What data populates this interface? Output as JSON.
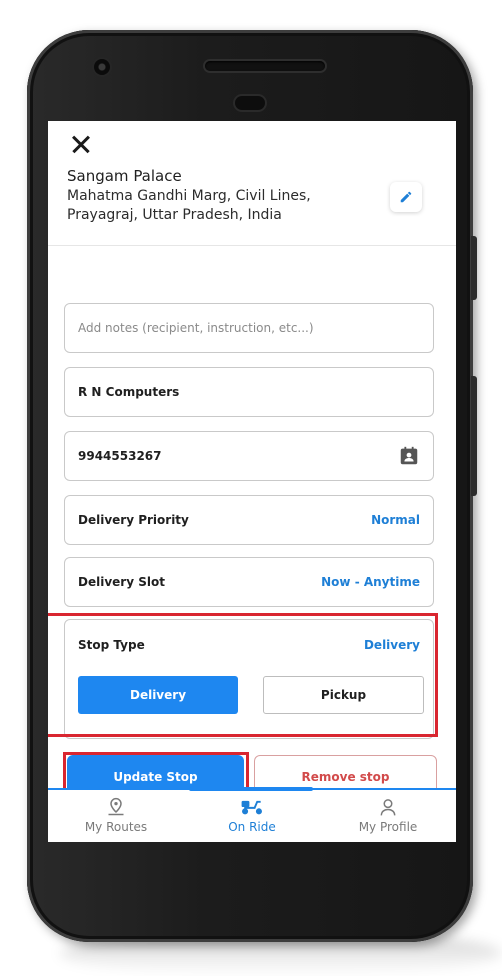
{
  "location": {
    "name": "Sangam Palace",
    "address": "Mahatma Gandhi Marg, Civil Lines, Prayagraj, Uttar Pradesh, India"
  },
  "form": {
    "notes_placeholder": "Add notes (recipient, instruction, etc...)",
    "contact_name": "R N Computers",
    "phone": "9944553267",
    "priority_label": "Delivery Priority",
    "priority_value": "Normal",
    "slot_label": "Delivery Slot",
    "slot_value": "Now - Anytime",
    "stop_type_label": "Stop Type",
    "stop_type_value": "Delivery",
    "stop_type_options": [
      "Delivery",
      "Pickup"
    ]
  },
  "actions": {
    "update_label": "Update Stop",
    "remove_label": "Remove stop"
  },
  "nav": {
    "items": [
      {
        "label": "My Routes",
        "icon": "route-pin-icon"
      },
      {
        "label": "On Ride",
        "icon": "scooter-icon"
      },
      {
        "label": "My Profile",
        "icon": "profile-icon"
      }
    ],
    "active_index": 1
  },
  "colors": {
    "accent": "#1e87f0",
    "accent_text": "#1e7fd6",
    "remove_text": "#d24a4a",
    "highlight": "#d92630"
  }
}
